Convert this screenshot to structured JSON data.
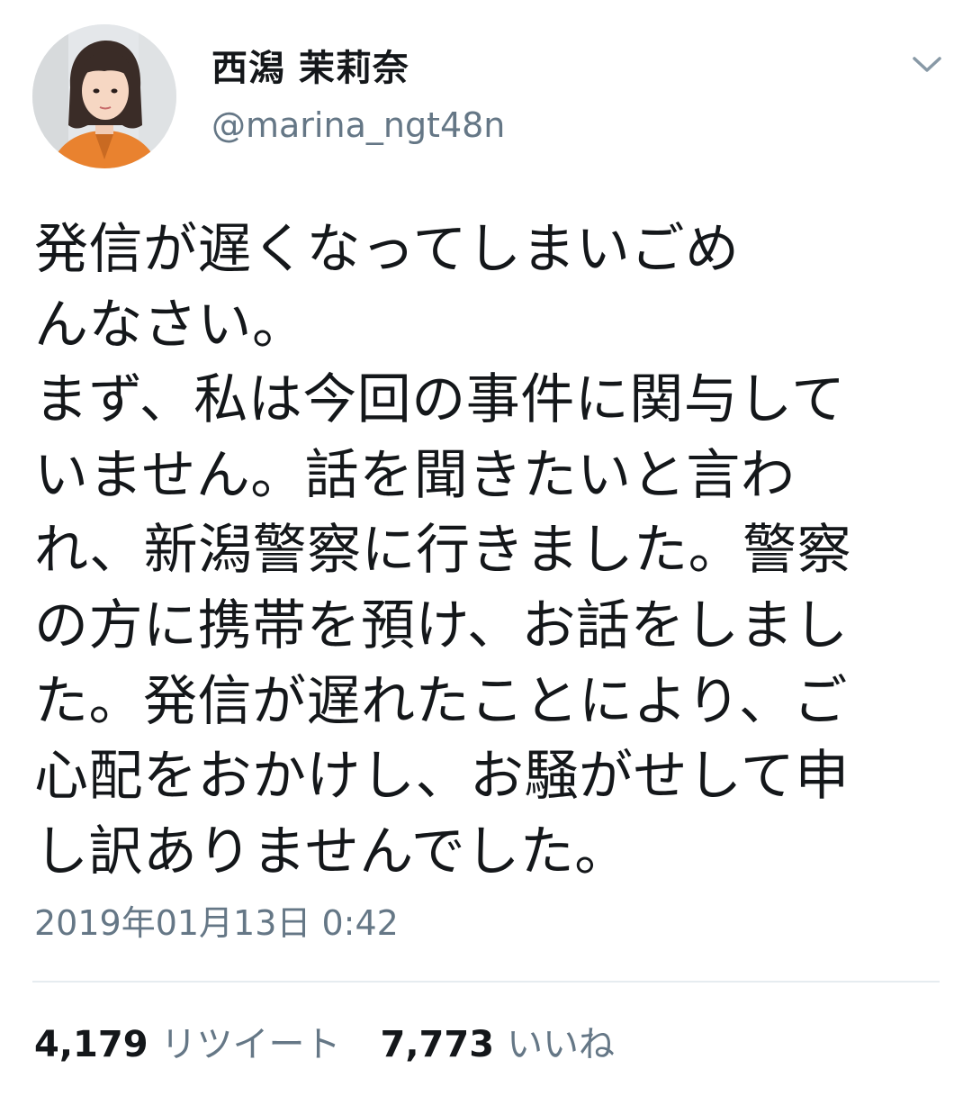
{
  "user": {
    "display_name": "西潟 茉莉奈",
    "handle": "@marina_ngt48n",
    "avatar_icon": "profile-photo"
  },
  "tweet": {
    "text": "発信が遅くなってしまいごめ\nんなさい。\nまず、私は今回の事件に関与して\nいません。話を聞きたいと言わ\nれ、新潟警察に行きました。警察\nの方に携帯を預け、お話をしまし\nた。発信が遅れたことにより、ご\n心配をおかけし、お騒がせして申\nし訳ありませんでした。",
    "timestamp": "2019年01月13日 0:42"
  },
  "stats": {
    "retweets_count": "4,179",
    "retweets_label": "リツイート",
    "likes_count": "7,773",
    "likes_label": "いいね"
  },
  "colors": {
    "text_primary": "#14171a",
    "text_secondary": "#657786",
    "divider": "#e6ecf0",
    "background": "#ffffff"
  }
}
